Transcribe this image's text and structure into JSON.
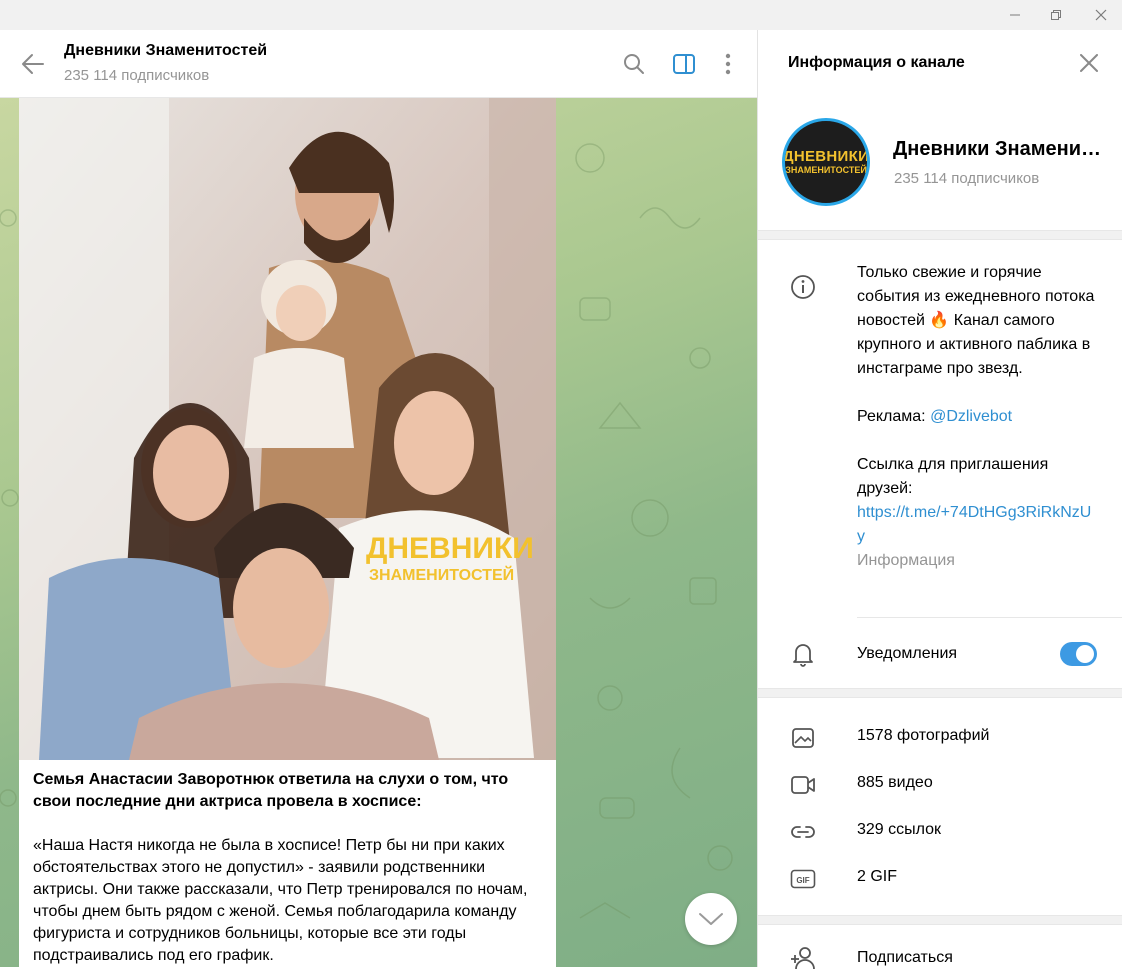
{
  "window": {
    "controls": [
      "minimize-icon",
      "maximize-icon",
      "close-icon"
    ]
  },
  "chat": {
    "title": "Дневники Знаменитостей",
    "subscribers": "235 114 подписчиков",
    "message": {
      "photo_watermark_line1": "ДНЕВНИКИ",
      "photo_watermark_line2": "ЗНАМЕНИТОСТЕЙ",
      "bold": "Семья Анастасии Заворотнюк ответила на слухи о том, что свои последние дни актриса провела в хосписе:",
      "body": "«Наша Настя никогда не была в хосписе! Петр бы ни при каких обстоятельствах этого не допустил» - заявили родственники актрисы. Они также рассказали, что Петр тренировался по ночам, чтобы днем быть рядом с женой. Семья поблагодарила команду фигуриста и сотрудников больницы, которые все эти годы подстраивались под его график."
    }
  },
  "panel": {
    "title": "Информация о канале",
    "channel_name": "Дневники Знаменитостей",
    "subscribers": "235 114 подписчиков",
    "avatar_line1": "ДНЕВНИКИ",
    "avatar_line2": "ЗНАМЕНИТОСТЕЙ",
    "about_line1": "Только свежие и горячие события из ежедневного потока новостей 🔥 Канал самого крупного и активного паблика в инстаграме про звезд.",
    "ad_label": "Реклама: ",
    "ad_link": "@Dzlivebot",
    "invite_label": "Ссылка для приглашения друзей:",
    "invite_link": "https://t.me/+74DtHGg3RiRkNzUy",
    "info_caption": "Информация",
    "notifications_label": "Уведомления",
    "notifications_on": true,
    "media": [
      {
        "icon": "photo-icon",
        "label": "1578 фотографий"
      },
      {
        "icon": "video-icon",
        "label": "885 видео"
      },
      {
        "icon": "link-icon",
        "label": "329 ссылок"
      },
      {
        "icon": "gif-icon",
        "label": "2 GIF"
      }
    ],
    "subscribe_label": "Подписаться"
  }
}
